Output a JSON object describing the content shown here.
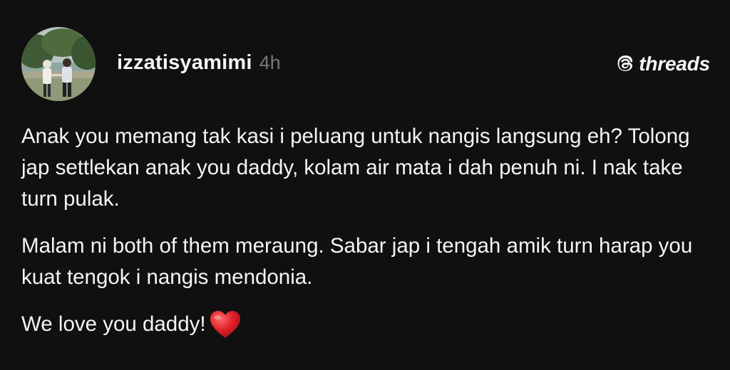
{
  "post": {
    "author": {
      "username": "izzatisyamimi",
      "timestamp": "4h",
      "avatar_icon": "profile-photo-couple"
    },
    "brand": {
      "label": "threads",
      "icon": "threads-logo-icon"
    },
    "paragraphs": [
      "Anak you memang tak kasi i peluang untuk nangis langsung eh? Tolong jap settlekan anak you daddy, kolam air mata i dah penuh ni. I nak take turn pulak.",
      "Malam ni both of them meraung. Sabar jap i tengah amik turn harap you kuat tengok i nangis mendonia.",
      "We love you daddy!"
    ],
    "emoji": {
      "name": "red-heart",
      "color": "#e0202a"
    }
  },
  "colors": {
    "background": "#101010",
    "text_primary": "#f3f5f7",
    "text_secondary": "#777777"
  }
}
